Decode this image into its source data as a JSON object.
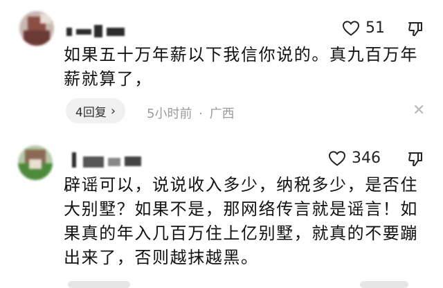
{
  "comments": [
    {
      "likes": "51",
      "lines": [
        "如果五十万年薪以下我信你说的。真九百万年",
        "薪就算了，"
      ],
      "reply_label": "4回复",
      "time": "5小时前",
      "separator": "·",
      "location": "广西"
    },
    {
      "likes": "346",
      "lines": [
        "辟谣可以，说说收入多少，纳税多少，是否住",
        "大别墅？如果不是，那网络传言就是谣言！如",
        "果真的年入几百万住上亿别墅，就真的不要蹦",
        "出来了，否则越抹越黑。"
      ]
    }
  ],
  "icons": {
    "like": "heart-outline-icon",
    "dislike": "thumbs-down-icon",
    "close": "close-x-icon",
    "chevron": "chevron-right-icon"
  },
  "colors": {
    "text": "#111111",
    "meta": "#9a9a9a",
    "pill_bg": "#f0f0f0"
  }
}
